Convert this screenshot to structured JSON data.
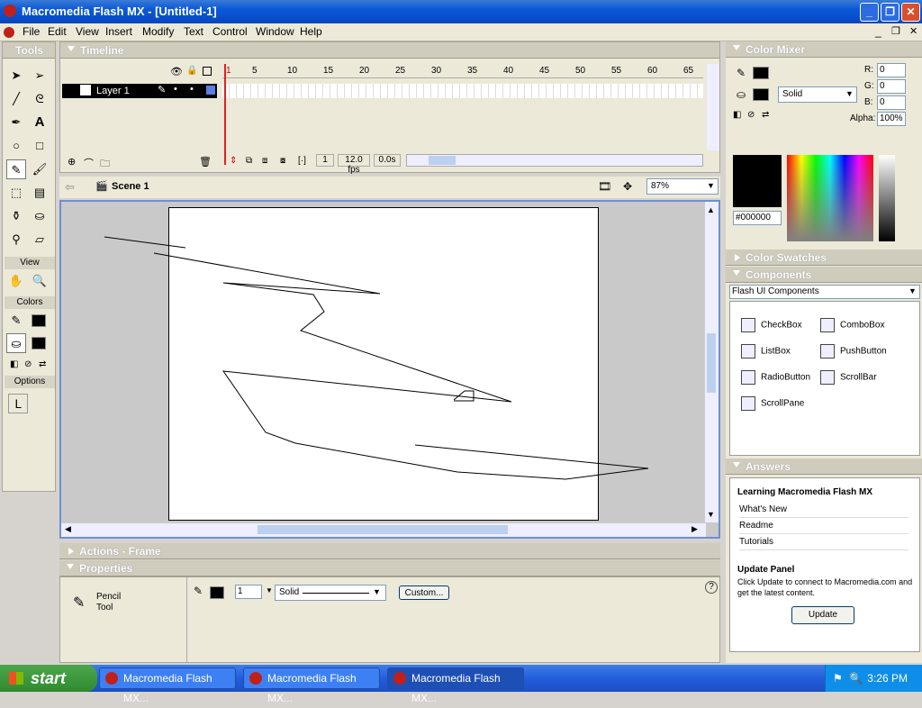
{
  "window": {
    "title": "Macromedia Flash MX - [Untitled-1]",
    "minimize": "_",
    "maximize": "❐",
    "close": "✕"
  },
  "menu": [
    "File",
    "Edit",
    "View",
    "Insert",
    "Modify",
    "Text",
    "Control",
    "Window",
    "Help"
  ],
  "tools": {
    "title": "Tools",
    "view_label": "View",
    "colors_label": "Colors",
    "options_label": "Options"
  },
  "timeline": {
    "title": "Timeline",
    "layer": "Layer 1",
    "ruler": [
      "1",
      "5",
      "10",
      "15",
      "20",
      "25",
      "30",
      "35",
      "40",
      "45",
      "50",
      "55",
      "60",
      "65"
    ],
    "current_frame": "1",
    "fps": "12.0 fps",
    "time": "0.0s"
  },
  "stage": {
    "scene": "Scene 1",
    "zoom": "87%"
  },
  "actions_panel": {
    "title": "Actions - Frame"
  },
  "properties": {
    "title": "Properties",
    "tool_line1": "Pencil",
    "tool_line2": "Tool",
    "stroke_size": "1",
    "stroke_style": "Solid",
    "custom_button": "Custom..."
  },
  "color_mixer": {
    "title": "Color Mixer",
    "fill_style": "Solid",
    "r_label": "R:",
    "r": "0",
    "g_label": "G:",
    "g": "0",
    "b_label": "B:",
    "b": "0",
    "alpha_label": "Alpha:",
    "alpha": "100%",
    "hex": "#000000"
  },
  "color_swatches": {
    "title": "Color Swatches"
  },
  "components": {
    "title": "Components",
    "set": "Flash UI Components",
    "items": [
      "CheckBox",
      "ComboBox",
      "ListBox",
      "PushButton",
      "RadioButton",
      "ScrollBar",
      "ScrollPane"
    ]
  },
  "answers": {
    "title": "Answers",
    "heading": "Learning Macromedia Flash MX",
    "links": [
      "What's New",
      "Readme",
      "Tutorials"
    ],
    "update_heading": "Update Panel",
    "update_text": "Click Update to connect to Macromedia.com and get the latest content.",
    "update_button": "Update"
  },
  "taskbar": {
    "start": "start",
    "tasks": [
      "Macromedia Flash MX...",
      "Macromedia Flash MX...",
      "Macromedia Flash MX..."
    ],
    "clock": "3:26 PM"
  },
  "colors": {
    "xp_blue": "#245edb",
    "panel_bg": "#ece9d8",
    "playhead": "#e02020"
  }
}
